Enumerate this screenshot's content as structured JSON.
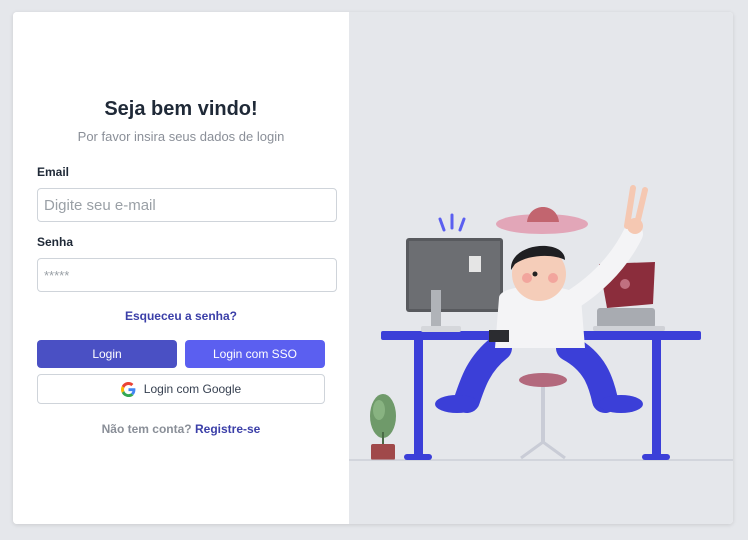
{
  "login": {
    "title": "Seja bem vindo!",
    "subtitle": "Por favor insira seus dados de login",
    "email_label": "Email",
    "email_placeholder": "Digite seu e-mail",
    "password_label": "Senha",
    "password_placeholder": "*****",
    "forgot_link": "Esqueceu a senha?",
    "login_button": "Login",
    "sso_button": "Login com SSO",
    "google_button": "Login com Google",
    "signup_prompt": "Não tem conta?",
    "signup_link": "Registre-se"
  },
  "colors": {
    "primary": "#4a50c4",
    "sso": "#5b5ff0",
    "link": "#3b3fa8",
    "illustration_blue": "#3b3fd8"
  },
  "icons": {
    "google": "google-icon"
  }
}
